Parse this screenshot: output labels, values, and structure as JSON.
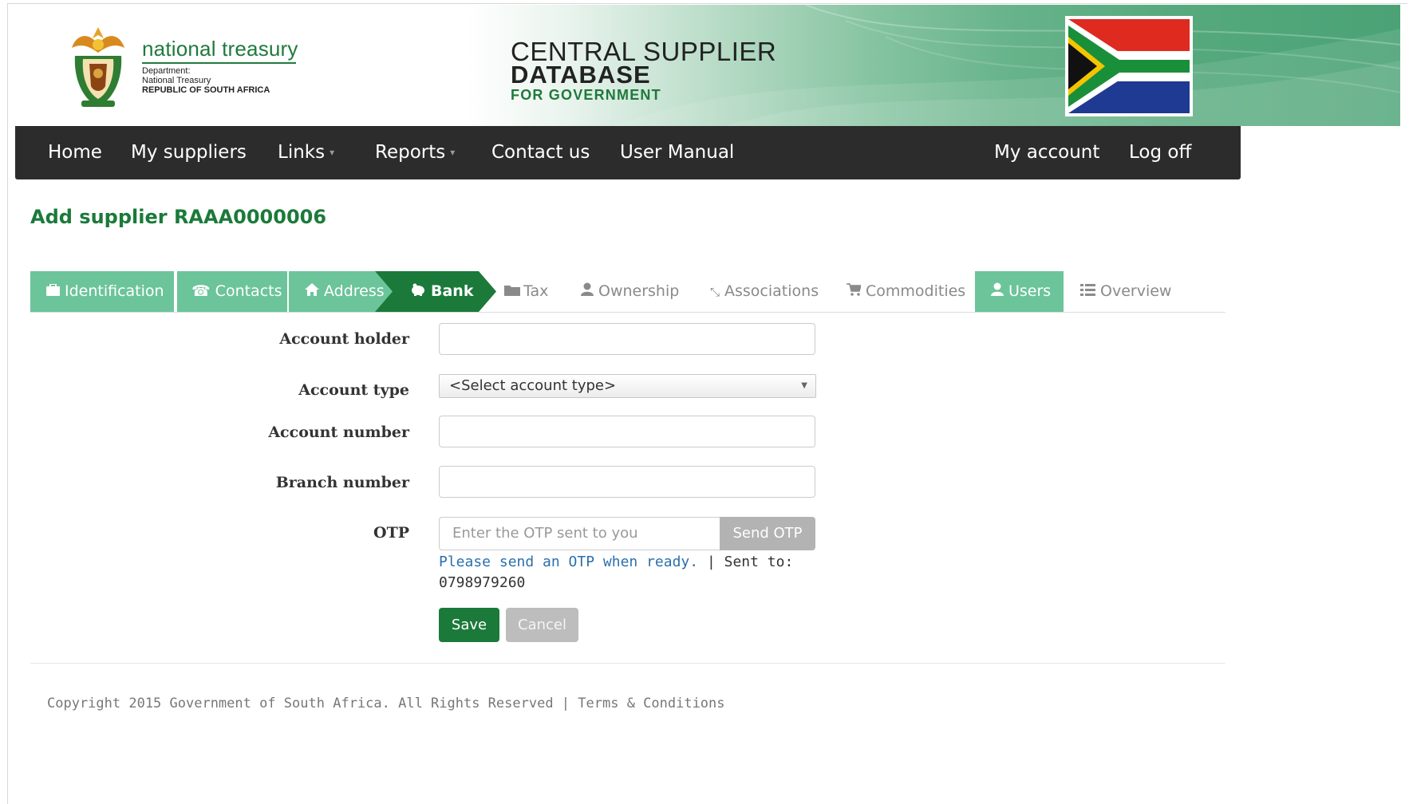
{
  "header": {
    "treasury_name": "national treasury",
    "dept_line1": "Department:",
    "dept_line2": "National Treasury",
    "dept_line3": "REPUBLIC OF SOUTH AFRICA",
    "title_line1": "CENTRAL SUPPLIER",
    "title_line2": "DATABASE",
    "title_line3": "FOR GOVERNMENT"
  },
  "nav": {
    "left": [
      {
        "label": "Home"
      },
      {
        "label": "My suppliers"
      },
      {
        "label": "Links",
        "dropdown": true
      },
      {
        "label": "Reports",
        "dropdown": true
      },
      {
        "label": "Contact us"
      },
      {
        "label": "User Manual"
      }
    ],
    "right": [
      {
        "label": "My account"
      },
      {
        "label": "Log off"
      }
    ]
  },
  "page": {
    "title": "Add supplier RAAA0000006"
  },
  "tabs": [
    {
      "label": "Identification",
      "icon": "briefcase-icon",
      "state": "done"
    },
    {
      "label": "Contacts",
      "icon": "phone-icon",
      "state": "done"
    },
    {
      "label": "Address",
      "icon": "home-icon",
      "state": "done"
    },
    {
      "label": "Bank",
      "icon": "piggy-bank-icon",
      "state": "active"
    },
    {
      "label": "Tax",
      "icon": "folder-icon",
      "state": "todo"
    },
    {
      "label": "Ownership",
      "icon": "user-icon",
      "state": "todo"
    },
    {
      "label": "Associations",
      "icon": "link-icon",
      "state": "todo"
    },
    {
      "label": "Commodities",
      "icon": "cart-icon",
      "state": "todo"
    },
    {
      "label": "Users",
      "icon": "user-icon",
      "state": "done"
    },
    {
      "label": "Overview",
      "icon": "list-icon",
      "state": "todo"
    }
  ],
  "form": {
    "account_holder_label": "Account holder",
    "account_holder_value": "",
    "account_type_label": "Account type",
    "account_type_selected": "<Select account type>",
    "account_number_label": "Account number",
    "account_number_value": "",
    "branch_number_label": "Branch number",
    "branch_number_value": "",
    "otp_label": "OTP",
    "otp_placeholder": "Enter the OTP sent to you",
    "send_otp_label": "Send OTP",
    "otp_link": "Please send an OTP when ready.",
    "otp_sent_to_label": " | Sent to:",
    "otp_phone": "0798979260",
    "save_label": "Save",
    "cancel_label": "Cancel"
  },
  "footer": {
    "copyright": "Copyright 2015 Government of South Africa. All Rights Reserved | ",
    "terms": "Terms & Conditions"
  },
  "colors": {
    "brand_green": "#1b7a3a",
    "tab_done_green": "#6cc49a",
    "nav_bg": "#2c2c2c",
    "link_blue": "#2a6fad"
  }
}
